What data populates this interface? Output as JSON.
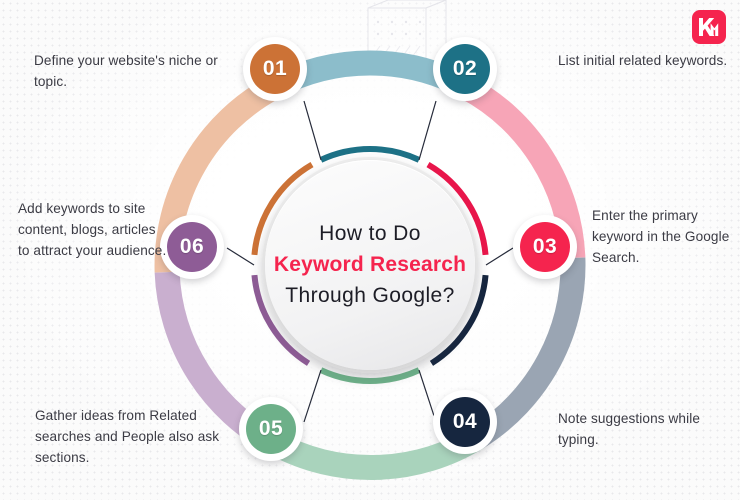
{
  "brand": {
    "logo_icon": "km-monogram-logo",
    "logo_color": "#F5244E",
    "logo_text": "KM"
  },
  "center": {
    "line1": "How to Do",
    "line2": "Keyword Research",
    "line3": "Through Google?",
    "accent_color": "#F5244E"
  },
  "steps": [
    {
      "number": "01",
      "color": "#CC7236",
      "ring_color": "#EEC0A3",
      "text": "Define your website's niche or topic."
    },
    {
      "number": "02",
      "color": "#1D7186",
      "ring_color": "#8CBDCB",
      "text": "List initial related keywords."
    },
    {
      "number": "03",
      "color": "#F5244E",
      "ring_color": "#F7A5B7",
      "text": "Enter the primary keyword in the Google Search."
    },
    {
      "number": "04",
      "color": "#16263F",
      "ring_color": "#9AA5B3",
      "text": "Note suggestions while typing."
    },
    {
      "number": "05",
      "color": "#6DB089",
      "ring_color": "#A9D3BC",
      "text": "Gather ideas from Related searches and People also ask sections."
    },
    {
      "number": "06",
      "color": "#8E5C96",
      "ring_color": "#C9AFCF",
      "text": "Add keywords to site content, blogs, articles to attract your audience."
    }
  ],
  "inner_ring_colors": {
    "seg_01_02": "#1D7186",
    "seg_02_03": "#E8164B",
    "seg_03_04": "#16263F",
    "seg_04_05": "#6DB089",
    "seg_05_06": "#8E5C96",
    "seg_06_01": "#CC7236"
  }
}
